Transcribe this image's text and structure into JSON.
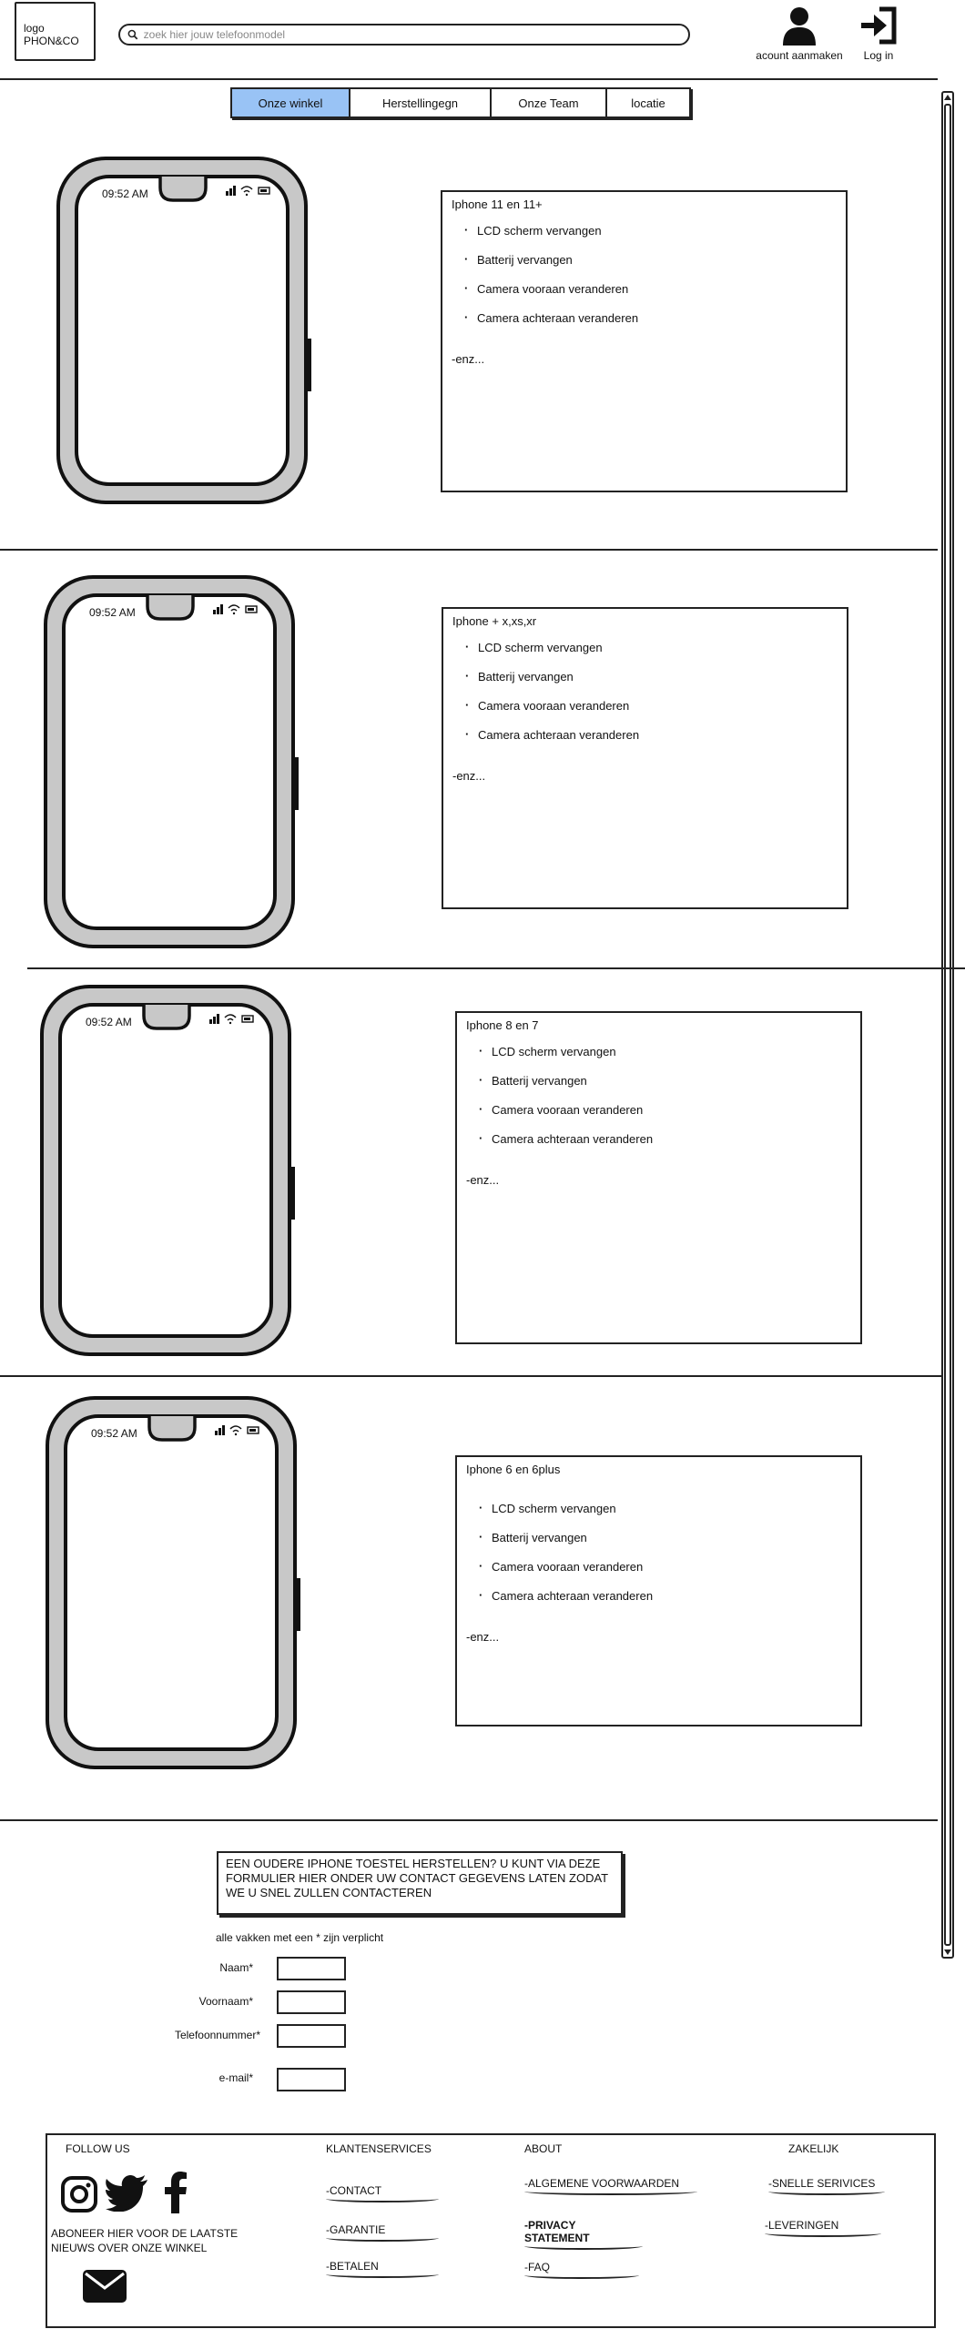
{
  "header": {
    "logo_line1": "logo",
    "logo_line2": "PHON&CO",
    "search_placeholder": "zoek hier jouw telefoonmodel",
    "create_account_label": "acount aanmaken",
    "login_label": "Log in"
  },
  "tabs": [
    {
      "label": "Onze winkel",
      "active": true
    },
    {
      "label": "Herstellingegn",
      "active": false
    },
    {
      "label": "Onze Team",
      "active": false
    },
    {
      "label": "locatie",
      "active": false
    }
  ],
  "phone_status": {
    "time": "09:52 AM"
  },
  "products": [
    {
      "title": "Iphone 11 en 11+",
      "items": [
        "LCD scherm vervangen",
        "Batterij vervangen",
        "Camera vooraan veranderen",
        "Camera achteraan veranderen"
      ],
      "more": "-enz..."
    },
    {
      "title": "Iphone + x,xs,xr",
      "items": [
        "LCD scherm vervangen",
        "Batterij vervangen",
        "Camera vooraan veranderen",
        "Camera achteraan veranderen"
      ],
      "more": "-enz..."
    },
    {
      "title": "Iphone 8 en 7",
      "items": [
        "LCD scherm vervangen",
        "Batterij vervangen",
        "Camera vooraan veranderen",
        "Camera achteraan veranderen"
      ],
      "more": "-enz..."
    },
    {
      "title": "Iphone 6 en 6plus",
      "items": [
        "LCD scherm vervangen",
        "Batterij vervangen",
        "Camera vooraan veranderen",
        "Camera achteraan veranderen"
      ],
      "more": "-enz..."
    }
  ],
  "form": {
    "notice": "EEN OUDERE IPHONE TOESTEL HERSTELLEN? U KUNT VIA DEZE FORMULIER HIER ONDER UW CONTACT GEGEVENS LATEN ZODAT WE U SNEL ZULLEN CONTACTEREN",
    "required_note": "alle vakken met een * zijn verplicht",
    "fields": [
      {
        "label": "Naam*",
        "value": ""
      },
      {
        "label": "Voornaam*",
        "value": ""
      },
      {
        "label": "Telefoonnummer*",
        "value": ""
      },
      {
        "label": "e-mail*",
        "value": ""
      }
    ]
  },
  "footer": {
    "follow_heading": "FOLLOW US",
    "newsletter_text": "ABONEER HIER VOOR DE LAATSTE NIEUWS OVER ONZE WINKEL",
    "icons": [
      "instagram-icon",
      "twitter-icon",
      "facebook-icon",
      "mail-icon"
    ],
    "columns": [
      {
        "heading": "KLANTENSERVICES",
        "links": [
          "-CONTACT",
          "-GARANTIE",
          "-BETALEN"
        ]
      },
      {
        "heading": "ABOUT",
        "links": [
          "-ALGEMENE VOORWAARDEN",
          "-PRIVACY STATEMENT",
          "-FAQ"
        ]
      },
      {
        "heading": "ZAKELIJK",
        "links": [
          "-SNELLE SERIVICES",
          "-LEVERINGEN"
        ]
      }
    ]
  },
  "colors": {
    "active_tab": "#99c3f5",
    "phone_frame": "#c8c8c8",
    "ink": "#222222"
  }
}
